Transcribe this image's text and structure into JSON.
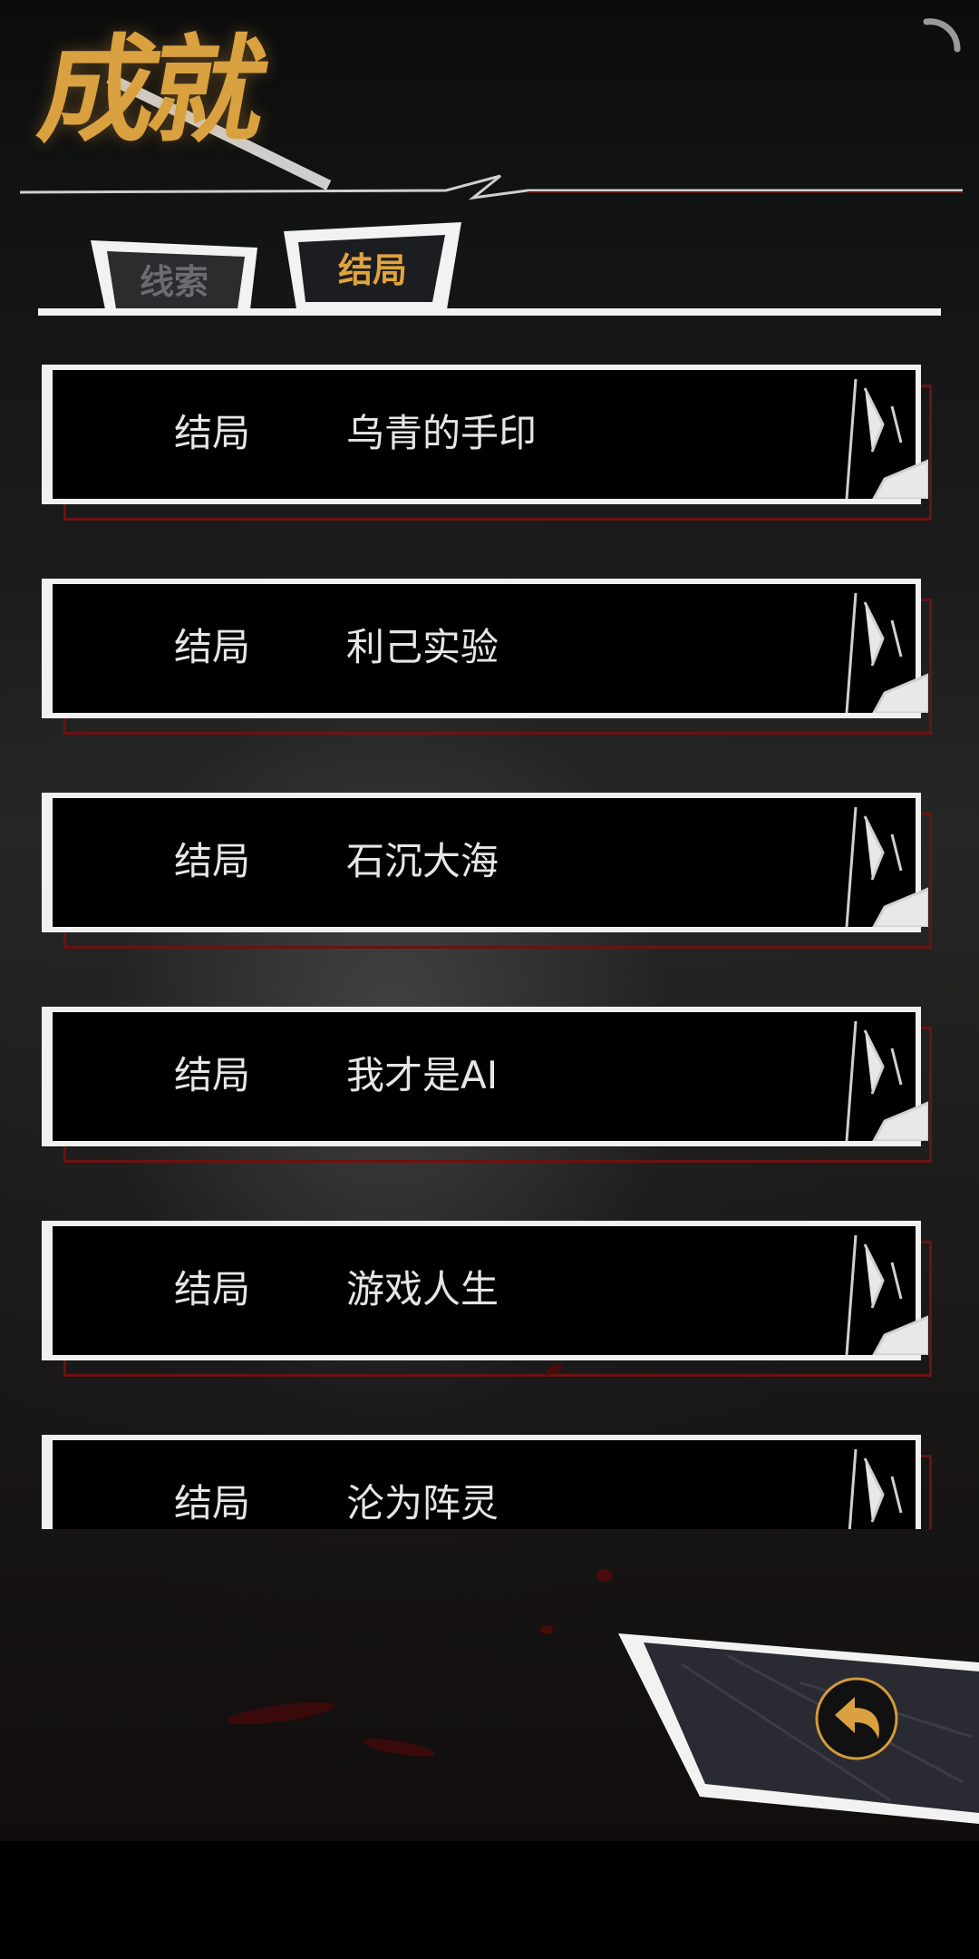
{
  "title": "成就",
  "tabs": [
    {
      "label": "线索",
      "active": false
    },
    {
      "label": "结局",
      "active": true
    }
  ],
  "endings": [
    {
      "kind": "结局",
      "name": "乌青的手印"
    },
    {
      "kind": "结局",
      "name": "利己实验"
    },
    {
      "kind": "结局",
      "name": "石沉大海"
    },
    {
      "kind": "结局",
      "name": "我才是AI"
    },
    {
      "kind": "结局",
      "name": "游戏人生"
    },
    {
      "kind": "结局",
      "name": "沦为阵灵"
    }
  ],
  "icons": {
    "spinner": "loading-spinner-icon",
    "back": "back-arrow-icon"
  },
  "colors": {
    "accent_gold": "#e0a43e",
    "inactive_tab": "#6a6c70",
    "card_border": "#f0f0f0",
    "card_shadow_red": "#6b1212"
  }
}
